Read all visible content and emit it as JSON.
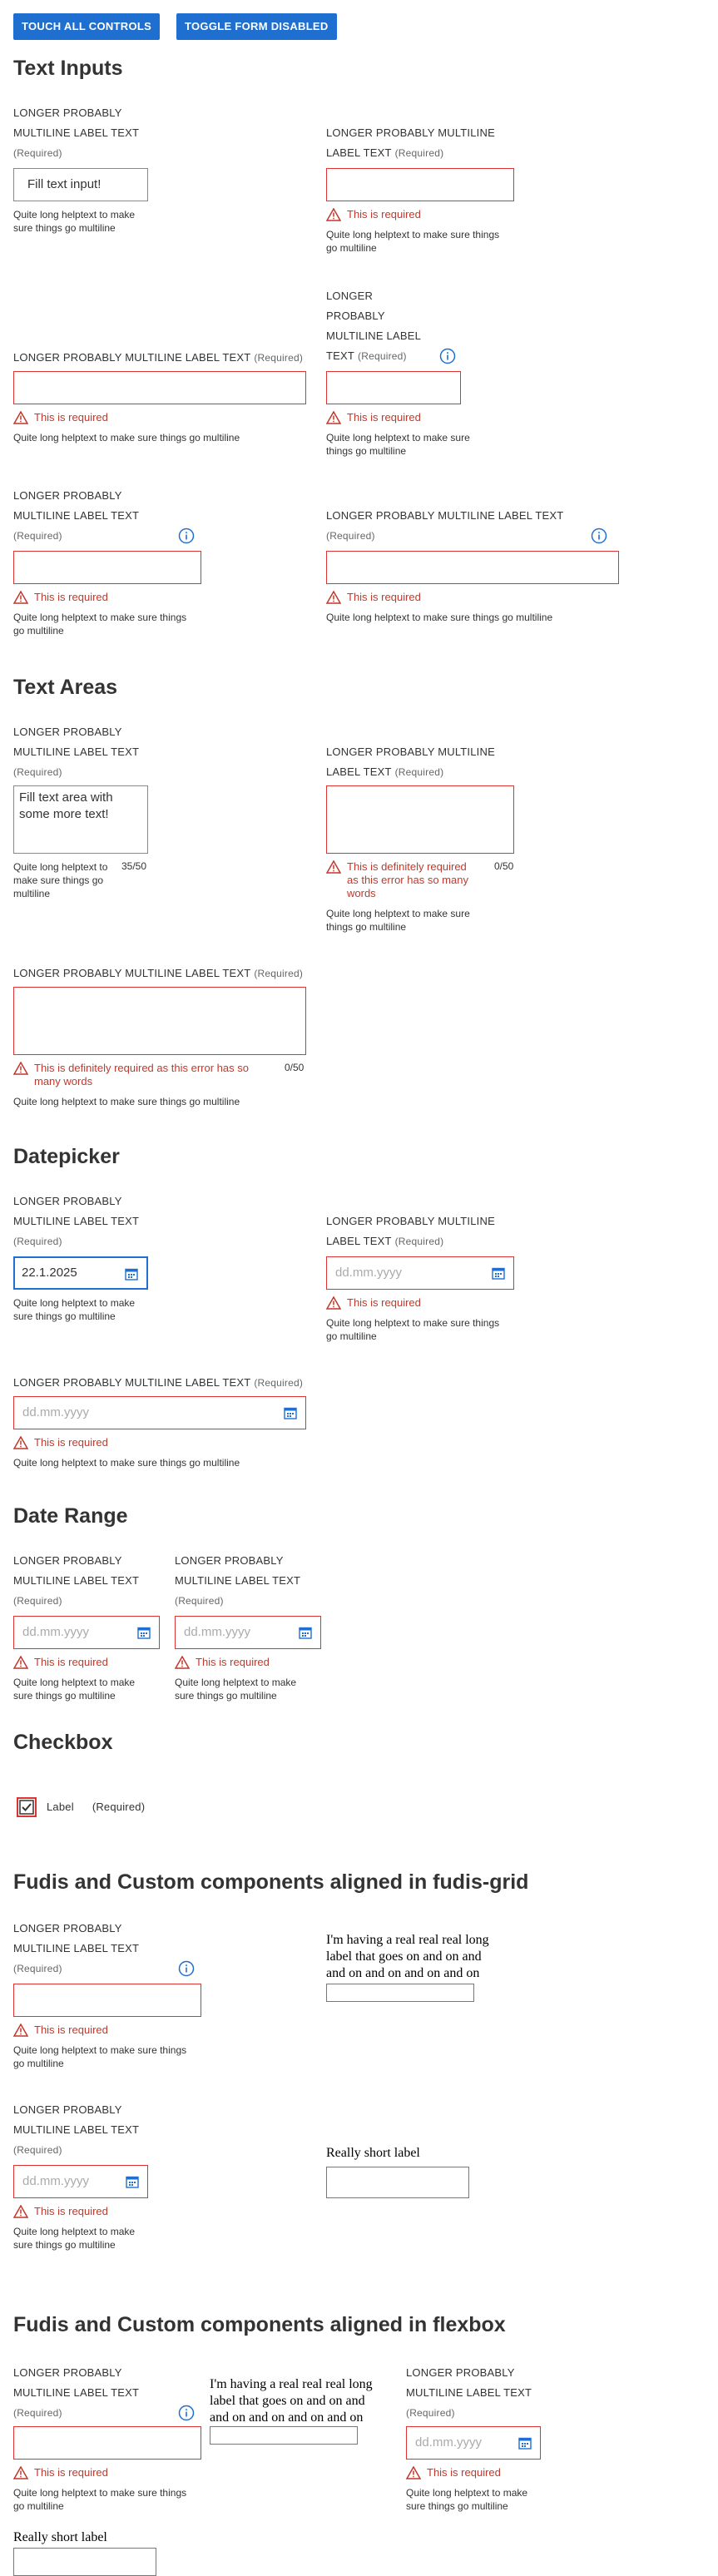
{
  "toolbar": {
    "touch_all": "TOUCH ALL CONTROLS",
    "toggle_disabled": "TOGGLE FORM DISABLED"
  },
  "common": {
    "label_long": "LONGER PROBABLY MULTILINE LABEL TEXT",
    "label_p1": "LONGER PROBABLY",
    "label_p2": "MULTILINE LABEL TEXT",
    "label_q1": "LONGER PROBABLY MULTILINE",
    "label_q2": "LABEL TEXT",
    "label_n1": "LONGER",
    "label_n2": "PROBABLY",
    "label_n3": "MULTILINE LABEL",
    "label_n4": "TEXT",
    "required": "(Required)",
    "error_required": "This is required",
    "error_long": "This is definitely required as this error has so many words",
    "error_long_a": "This is definitely required",
    "error_long_b": "as this error has so many",
    "error_long_c": "words",
    "help_full": "Quite long helptext to make sure things go multiline",
    "help_a1": "Quite long helptext to make",
    "help_a2": "sure things go multiline",
    "help_b1": "Quite long helptext to make sure things",
    "help_b2": "go multiline",
    "help_c1": "Quite long helptext to make sure",
    "help_c2": "things go multiline",
    "help_t1": "Quite long helptext to",
    "help_t2": "make sure things go",
    "help_t3": "multiline",
    "date_placeholder": "dd.mm.yyyy"
  },
  "sections": {
    "text_inputs": "Text Inputs",
    "text_areas": "Text Areas",
    "datepicker": "Datepicker",
    "date_range": "Date Range",
    "checkbox": "Checkbox",
    "grid": "Fudis and Custom components aligned in fudis-grid",
    "flexbox": "Fudis and Custom components aligned in flexbox"
  },
  "text_inputs": {
    "first_value": "Fill text input!"
  },
  "text_areas": {
    "first_value": "Fill text area with some more text!",
    "first_count": "35/50",
    "second_count": "0/50",
    "third_count": "0/50"
  },
  "datepicker": {
    "first_value": "22.1.2025"
  },
  "checkbox": {
    "label": "Label",
    "required": "(Required)"
  },
  "custom": {
    "long_label_1": "I'm having a real real real long",
    "long_label_2": "label that goes on and on and",
    "long_label_3": "and on and on and on and on",
    "short_label": "Really short label"
  }
}
